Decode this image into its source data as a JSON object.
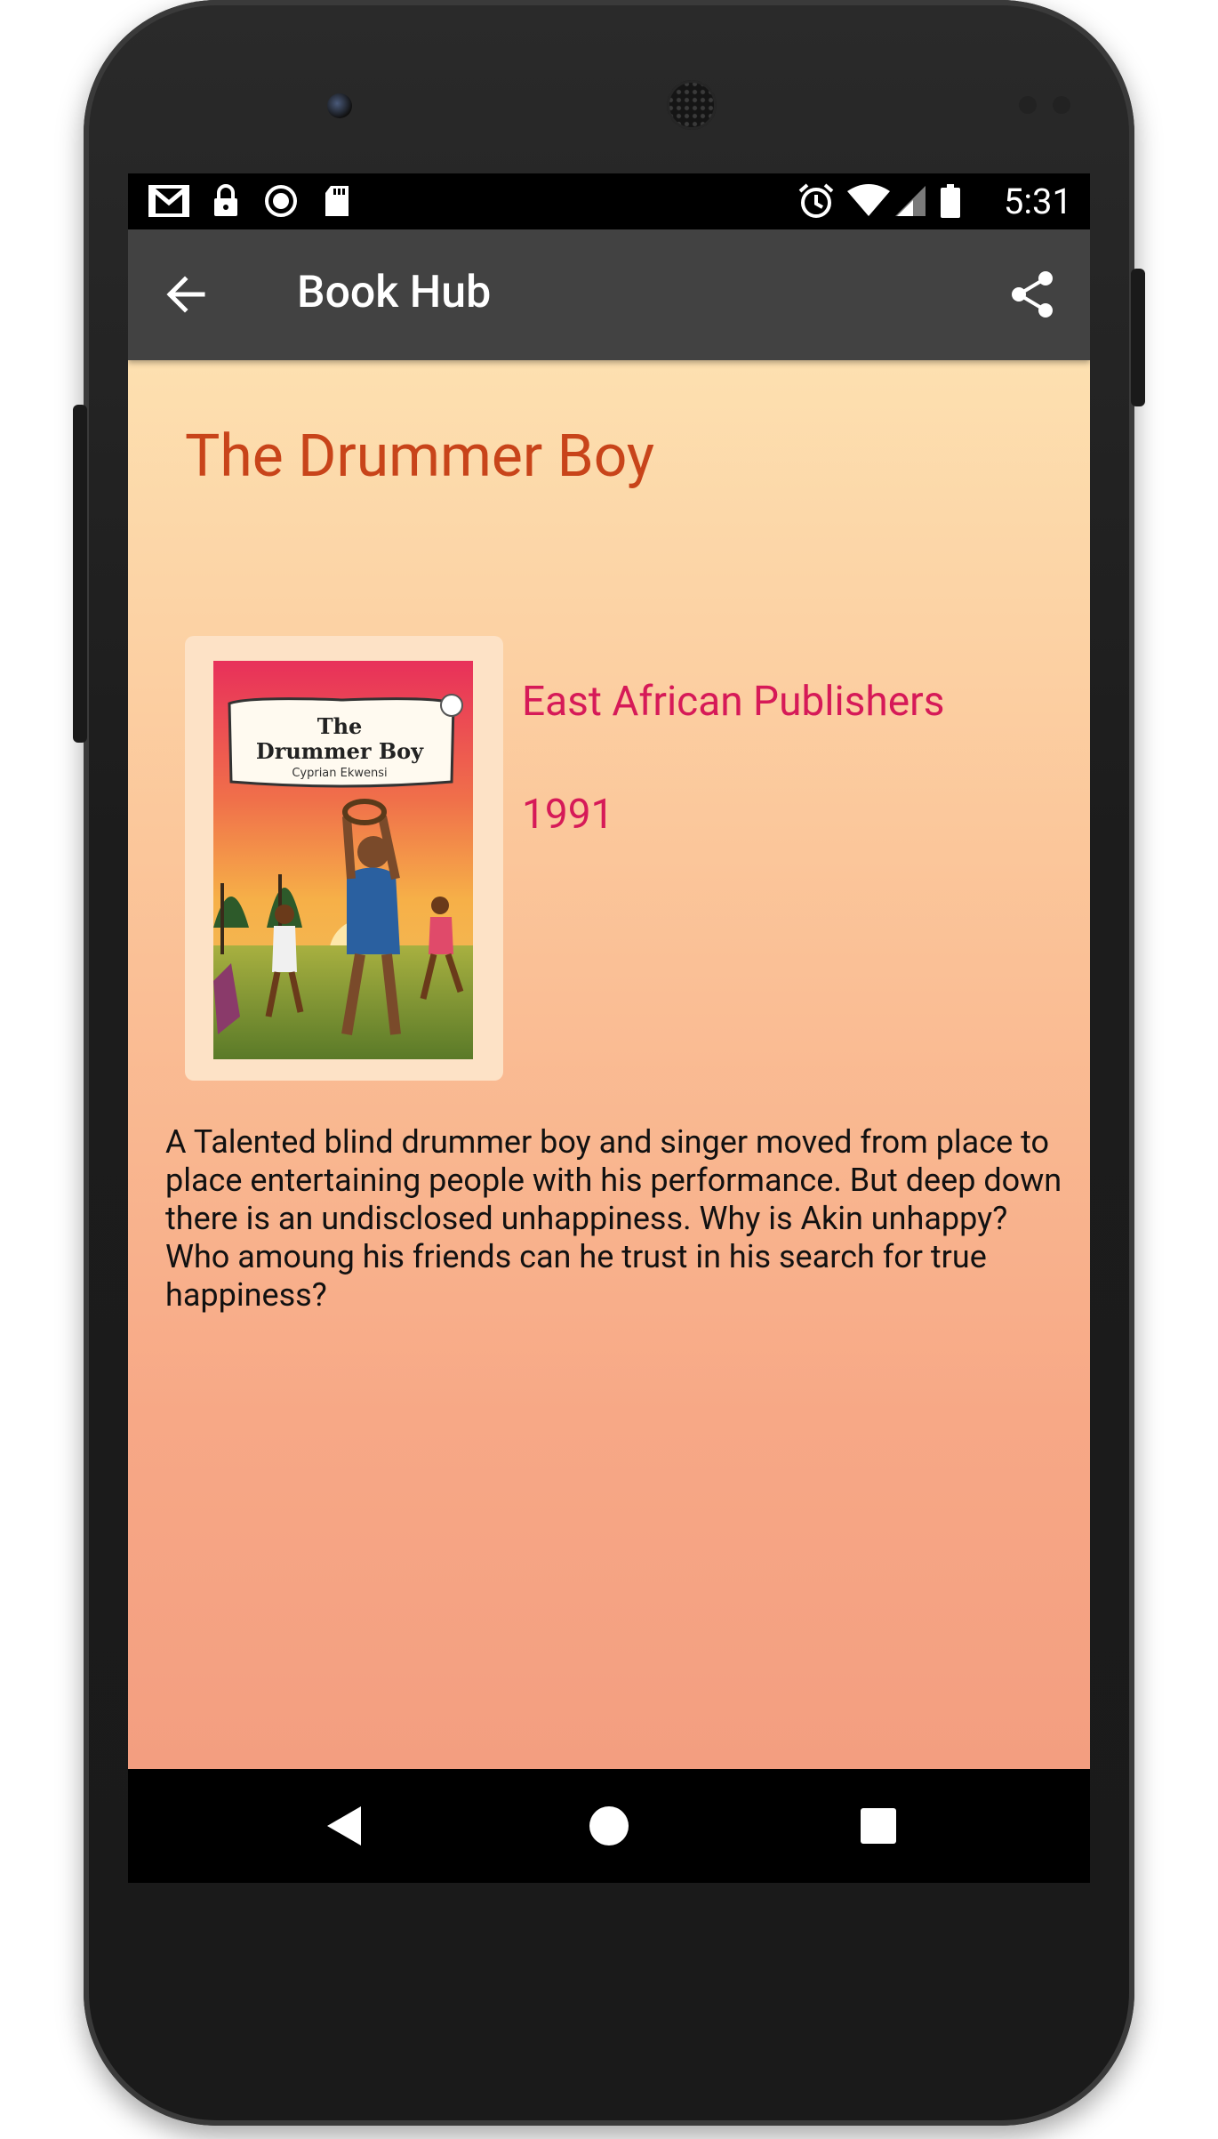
{
  "statusbar": {
    "time": "5:31",
    "icons": [
      "gmail-icon",
      "lock-icon",
      "record-icon",
      "sd-card-icon",
      "alarm-icon",
      "wifi-icon",
      "signal-icon",
      "battery-icon"
    ]
  },
  "appbar": {
    "title": "Book Hub",
    "back_icon": "arrow-back-icon",
    "share_icon": "share-icon"
  },
  "book": {
    "title": "The Drummer Boy",
    "publisher": "East African Publishers",
    "year": "1991",
    "description": "A Talented blind drummer boy and singer moved from place to place entertaining people with his performance. But deep down there is an undisclosed unhappiness. Why is Akin unhappy? Who amoung his friends can he trust in his search for true happiness?",
    "cover": {
      "title_line1": "The",
      "title_line2": "Drummer Boy",
      "author": "Cyprian Ekwensi"
    }
  },
  "navbar": {
    "icons": [
      "nav-back-icon",
      "nav-home-icon",
      "nav-recents-icon"
    ]
  },
  "colors": {
    "appbar": "#424242",
    "title": "#c8441a",
    "accent": "#d61a58"
  }
}
